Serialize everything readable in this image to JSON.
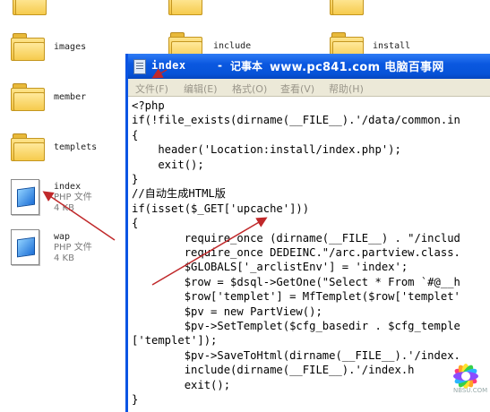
{
  "desktop": {
    "folders": [
      {
        "label": "images"
      },
      {
        "label": "member"
      },
      {
        "label": "templets"
      },
      {
        "label": "include"
      },
      {
        "label": "install"
      }
    ],
    "files": [
      {
        "name": "index",
        "type": "PHP 文件",
        "size": "4 KB"
      },
      {
        "name": "wap",
        "type": "PHP 文件",
        "size": "4 KB"
      }
    ]
  },
  "window": {
    "filename": "index",
    "separator": "-",
    "app": "记事本",
    "watermark_url": "www.pc841.com",
    "watermark_cn": "电脑百事网",
    "menu": [
      "文件(F)",
      "编辑(E)",
      "格式(O)",
      "查看(V)",
      "帮助(H)"
    ],
    "code_lines": [
      "<?php",
      "if(!file_exists(dirname(__FILE__).'/data/common.in",
      "{",
      "    header('Location:install/index.php');",
      "    exit();",
      "}",
      "//自动生成HTML版",
      "if(isset($_GET['upcache']))",
      "{",
      "        require_once (dirname(__FILE__) . \"/includ",
      "        require_once DEDEINC.\"/arc.partview.class.",
      "        $GLOBALS['_arclistEnv'] = 'index';",
      "        $row = $dsql->GetOne(\"Select * From `#@__h",
      "        $row['templet'] = MfTemplet($row['templet'",
      "        $pv = new PartView();",
      "        $pv->SetTemplet($cfg_basedir . $cfg_temple",
      "['templet']);",
      "        $pv->SaveToHtml(dirname(__FILE__).'/index.",
      "        include(dirname(__FILE__).'/index.h",
      "        exit();",
      "}"
    ]
  },
  "corner_logo_text": "NBSU.COM",
  "colors": {
    "titlebar": "#0653d8",
    "menubar": "#ece9d8",
    "arrow": "#c0282a"
  }
}
